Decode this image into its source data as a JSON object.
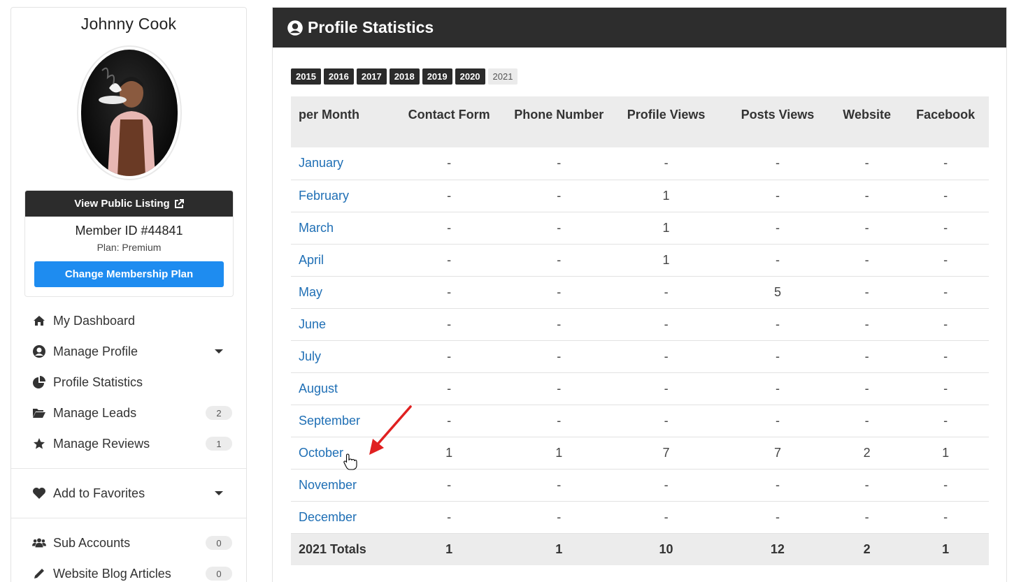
{
  "member": {
    "name": "Johnny Cook",
    "view_listing_label": "View Public Listing",
    "member_id": "Member ID #44841",
    "plan": "Plan: Premium",
    "change_plan_label": "Change Membership Plan"
  },
  "nav": {
    "items": [
      {
        "label": "My Dashboard",
        "icon": "home-icon"
      },
      {
        "label": "Manage Profile",
        "icon": "user-circle-icon",
        "caret": true
      },
      {
        "label": "Profile Statistics",
        "icon": "pie-chart-icon"
      },
      {
        "label": "Manage Leads",
        "icon": "folder-open-icon",
        "badge": "2"
      },
      {
        "label": "Manage Reviews",
        "icon": "star-icon",
        "badge": "1"
      }
    ],
    "favorites": {
      "label": "Add to Favorites",
      "icon": "heart-icon",
      "caret": true
    },
    "bottom_items": [
      {
        "label": "Sub Accounts",
        "icon": "users-icon",
        "badge": "0"
      },
      {
        "label": "Website Blog Articles",
        "icon": "pencil-icon",
        "badge": "0"
      }
    ]
  },
  "main": {
    "title": "Profile Statistics",
    "years": [
      "2015",
      "2016",
      "2017",
      "2018",
      "2019",
      "2020",
      "2021"
    ],
    "active_year": "2021",
    "table": {
      "headers": [
        "per Month",
        "Contact Form",
        "Phone Number",
        "Profile Views",
        "Posts Views",
        "Website",
        "Facebook"
      ],
      "rows": [
        {
          "month": "January",
          "values": [
            "-",
            "-",
            "-",
            "-",
            "-",
            "-"
          ]
        },
        {
          "month": "February",
          "values": [
            "-",
            "-",
            "1",
            "-",
            "-",
            "-"
          ]
        },
        {
          "month": "March",
          "values": [
            "-",
            "-",
            "1",
            "-",
            "-",
            "-"
          ]
        },
        {
          "month": "April",
          "values": [
            "-",
            "-",
            "1",
            "-",
            "-",
            "-"
          ]
        },
        {
          "month": "May",
          "values": [
            "-",
            "-",
            "-",
            "5",
            "-",
            "-"
          ]
        },
        {
          "month": "June",
          "values": [
            "-",
            "-",
            "-",
            "-",
            "-",
            "-"
          ]
        },
        {
          "month": "July",
          "values": [
            "-",
            "-",
            "-",
            "-",
            "-",
            "-"
          ]
        },
        {
          "month": "August",
          "values": [
            "-",
            "-",
            "-",
            "-",
            "-",
            "-"
          ]
        },
        {
          "month": "September",
          "values": [
            "-",
            "-",
            "-",
            "-",
            "-",
            "-"
          ]
        },
        {
          "month": "October",
          "values": [
            "1",
            "1",
            "7",
            "7",
            "2",
            "1"
          ]
        },
        {
          "month": "November",
          "values": [
            "-",
            "-",
            "-",
            "-",
            "-",
            "-"
          ]
        },
        {
          "month": "December",
          "values": [
            "-",
            "-",
            "-",
            "-",
            "-",
            "-"
          ]
        }
      ],
      "totals": {
        "label": "2021 Totals",
        "values": [
          "1",
          "1",
          "10",
          "12",
          "2",
          "1"
        ]
      }
    }
  },
  "colors": {
    "accent_blue": "#1e8cf0",
    "link_blue": "#1f6fb5",
    "header_dark": "#2d2d2d",
    "annotation_red": "#e02020"
  }
}
